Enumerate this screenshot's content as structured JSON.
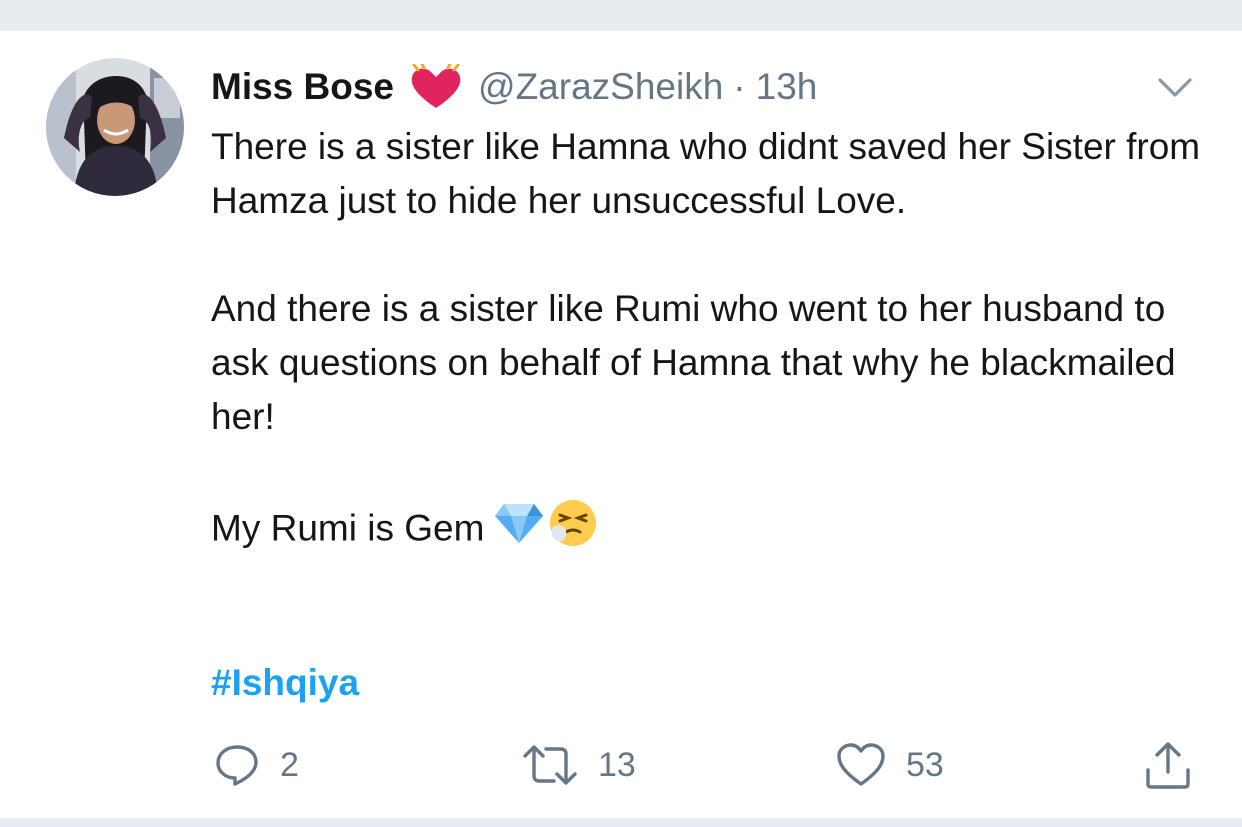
{
  "tweet": {
    "author": {
      "display_name": "Miss Bose",
      "name_emoji": "red-heart-with-sparkle",
      "handle": "@ZarazSheikh",
      "separator": "·",
      "timestamp": "13h"
    },
    "paragraphs": [
      "There is a sister like Hamna who didnt saved her Sister from Hamza just to hide her unsuccessful Love.",
      "And there is a sister like Rumi who went to her husband to ask questions on behalf of Hamna that why he blackmailed her!",
      "My Rumi is Gem"
    ],
    "last_paragraph_emojis": [
      "gem-stone",
      "sneezing-face"
    ],
    "hashtag": "#Ishqiya",
    "actions": {
      "reply_count": "2",
      "retweet_count": "13",
      "like_count": "53"
    }
  },
  "colors": {
    "hashtag": "#1da1f2",
    "secondary_text": "#657786",
    "divider": "#e6ecf0",
    "heart": "#e0245e"
  },
  "icons": [
    "chevron-down-icon",
    "reply-icon",
    "retweet-icon",
    "like-icon",
    "share-icon"
  ]
}
